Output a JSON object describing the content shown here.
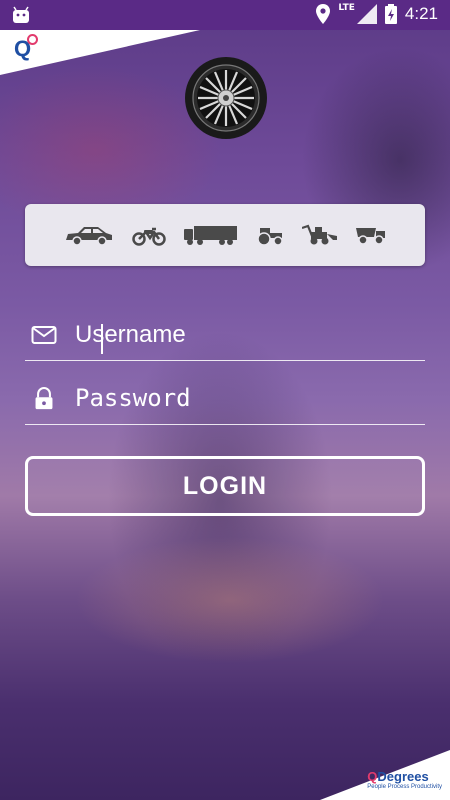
{
  "status_bar": {
    "network": "LTE",
    "time": "4:21",
    "colors": {
      "background": "#5a2a86",
      "foreground": "#ffffff"
    },
    "icons": [
      "android-debug-icon",
      "location-pin-icon",
      "signal-icon",
      "battery-charging-icon"
    ]
  },
  "header": {
    "logo_letter": "Q",
    "logo_alt": "QDegrees",
    "wheel_icon": "alloy-wheel-icon"
  },
  "vehicle_bar": {
    "items": [
      {
        "name": "car",
        "icon": "car-icon"
      },
      {
        "name": "motorcycle",
        "icon": "motorcycle-icon"
      },
      {
        "name": "truck",
        "icon": "truck-icon"
      },
      {
        "name": "tractor",
        "icon": "tractor-icon"
      },
      {
        "name": "backhoe",
        "icon": "backhoe-loader-icon"
      },
      {
        "name": "dumper",
        "icon": "dump-truck-icon"
      }
    ]
  },
  "login_form": {
    "username": {
      "placeholder": "Username",
      "value": "",
      "icon": "mail-icon"
    },
    "password": {
      "placeholder": "Password",
      "value": "",
      "icon": "lock-icon"
    },
    "login_button": "LOGIN"
  },
  "footer": {
    "brand_q": "Q",
    "brand_name": "Degrees",
    "tagline": "People Process Productivity"
  },
  "colors": {
    "accent": "#ffffff",
    "brand_blue": "#1f4fa3",
    "brand_pink": "#e23b6d",
    "vehicle_bar_bg": "#e9e7ee",
    "vehicle_icon": "#4a4a4a"
  }
}
